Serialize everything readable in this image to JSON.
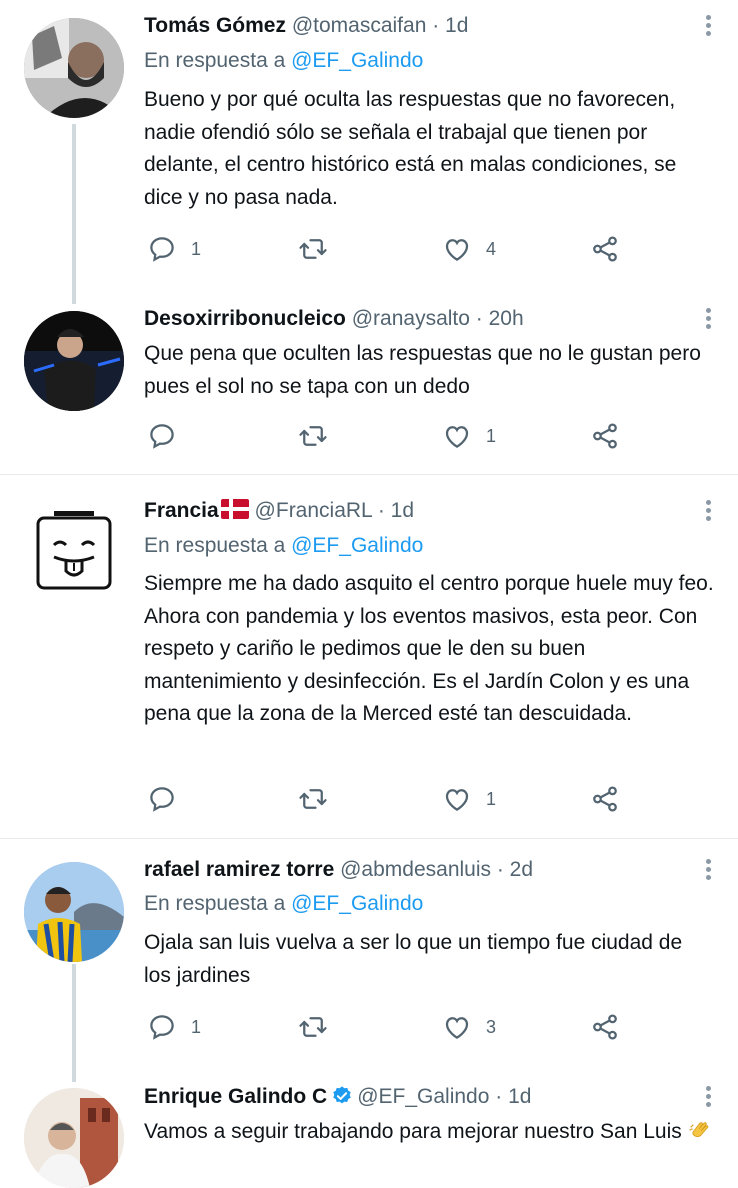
{
  "tweets": [
    {
      "name": "Tomás Gómez",
      "handle": "@tomascaifan",
      "time": "· 1d",
      "reply_prefix": "En respuesta a",
      "reply_to": "@EF_Galindo",
      "text": "Bueno y por qué oculta las respuestas que no favorecen, nadie ofendió sólo se señala el trabajal que tienen por delante, el centro histórico está en malas condiciones, se dice y no pasa nada.",
      "replies": "1",
      "retweets": "",
      "likes": "4"
    },
    {
      "name": "Desoxirribonucleico",
      "handle": "@ranaysalto",
      "time": "· 20h",
      "text": "Que pena que oculten las respuestas que no le gustan pero pues el sol no se tapa con un dedo",
      "replies": "",
      "retweets": "",
      "likes": "1"
    },
    {
      "name": "Francia",
      "handle": "@FranciaRL",
      "time": "· 1d",
      "reply_prefix": "En respuesta a",
      "reply_to": "@EF_Galindo",
      "text": "Siempre me ha dado asquito el centro porque huele muy feo. Ahora con pandemia y los eventos masivos, esta peor. Con respeto y cariño le pedimos que le den su buen mantenimiento y desinfección. Es el Jardín Colon y es una pena que la zona de la Merced esté tan descuidada.",
      "replies": "",
      "retweets": "",
      "likes": "1"
    },
    {
      "name": "rafael ramirez torre",
      "handle": "@abmdesanluis",
      "time": "· 2d",
      "reply_prefix": "En respuesta a",
      "reply_to": "@EF_Galindo",
      "text": "Ojala san luis vuelva a ser lo que un tiempo fue ciudad de los jardines",
      "replies": "1",
      "retweets": "",
      "likes": "3"
    },
    {
      "name": "Enrique Galindo C",
      "handle": "@EF_Galindo",
      "time": "· 1d",
      "text": "Vamos a seguir trabajando para mejorar nuestro San Luis"
    }
  ],
  "icons": {
    "reply": "speech-bubble-icon",
    "retweet": "retweet-icon",
    "like": "heart-icon",
    "share": "share-icon",
    "more": "more-vertical-icon",
    "verified": "verified-badge-icon",
    "flag": "denmark-flag-icon",
    "emoji": "clapping-hands-icon"
  },
  "colors": {
    "link": "#1d9bf0",
    "secondary": "#536471",
    "separator": "#e7e9ea",
    "thread_line": "#cfd9de"
  }
}
